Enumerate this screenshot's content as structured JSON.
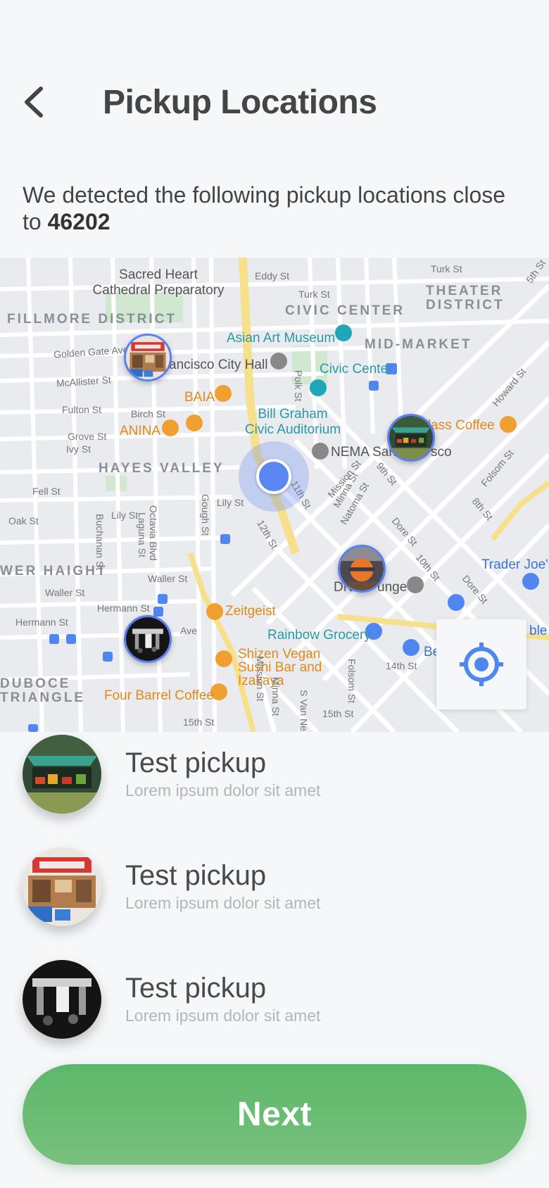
{
  "header": {
    "title": "Pickup Locations",
    "back_icon": "chevron-left-icon"
  },
  "intro": {
    "text": "We detected the following pickup locations close to",
    "zip": "46202"
  },
  "map": {
    "districts": [
      "FILLMORE DISTRICT",
      "CIVIC CENTER",
      "THEATER DISTRICT",
      "MID-MARKET",
      "HAYES VALLEY",
      "WER HAIGHT",
      "DUBOCE TRIANGLE"
    ],
    "places": {
      "sacred_heart": "Sacred Heart Cathedral Preparatory",
      "asian_art": "Asian Art Museum",
      "city_hall": "ancisco City Hall",
      "civic_center": "Civic Center",
      "bill_graham": "Bill Graham Civic Auditorium",
      "nema": "NEMA San",
      "nema2": "sco",
      "baia": "BAIA",
      "anina": "ANINA",
      "lass_coffee": "lass Coffee",
      "trader_joes": "Trader Joe's",
      "zeitgeist": "Zeitgeist",
      "rainbow": "Rainbow Grocery",
      "shizen": "Shizen Vegan Sushi Bar and Izakaya",
      "four_barrel": "Four Barrel Coffee",
      "dna_lounge": "DN",
      "dna_lounge2": "unge",
      "ble": "ble",
      "be": "Be"
    },
    "streets": {
      "golden_gate": "Golden Gate Ave",
      "mcallister": "McAllister St",
      "fulton": "Fulton St",
      "grove": "Grove St",
      "ivy": "Ivy St",
      "fell": "Fell St",
      "oak": "Oak St",
      "waller": "Waller St",
      "hermann": "Hermann St",
      "octavia": "Octavia Blvd",
      "gough": "Gough St",
      "turk": "Turk St",
      "eddy": "Eddy St",
      "polk": "Polk St",
      "mission": "Mission St",
      "ninth": "9th St",
      "folsom": "Folsom St",
      "howard": "Howard St",
      "eighth": "8th St",
      "tenth": "10th St",
      "twelfth": "12th St",
      "fourteenth": "14th St",
      "fifteenth": "15th St",
      "svanness": "S Van Ne",
      "minna": "Minna St",
      "natoma": "Natoma St",
      "dore": "Dore St",
      "lily": "Lily St",
      "laguna": "Laguna St",
      "buchanan": "Buchanan St",
      "birch": "Birch St",
      "fifth": "5th St",
      "ave": "Ave",
      "eleventh": "11th St"
    },
    "locate_icon": "crosshair-target-icon"
  },
  "list": [
    {
      "title": "Test pickup",
      "subtitle": "Lorem ipsum dolor sit amet",
      "image": "fruit-stand-photo"
    },
    {
      "title": "Test pickup",
      "subtitle": "Lorem ipsum dolor sit amet",
      "image": "coca-cola-kiosk-photo"
    },
    {
      "title": "Test pickup",
      "subtitle": "Lorem ipsum dolor sit amet",
      "image": "night-market-photo"
    }
  ],
  "next_label": "Next",
  "colors": {
    "accent": "#5b87f2",
    "button_green": "#66bb6e",
    "map_poi": "#e08a1c",
    "map_teal": "#2a98a8"
  }
}
